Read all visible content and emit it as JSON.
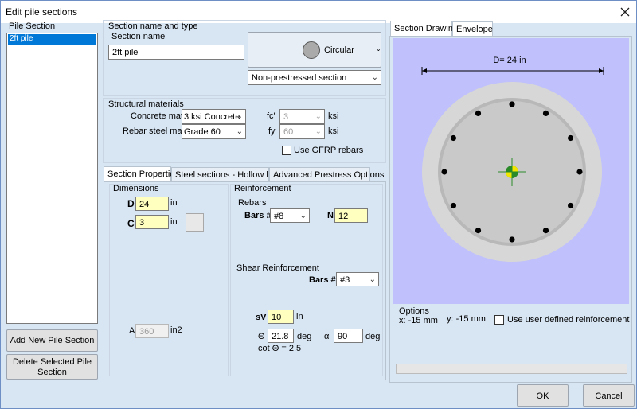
{
  "window": {
    "title": "Edit pile sections"
  },
  "pile_section_list": {
    "header": "Pile Section",
    "items": [
      "2ft pile"
    ],
    "selected_index": 0
  },
  "section_name_type": {
    "group_label": "Section name and type",
    "name_label": "Section name",
    "name_value": "2ft pile",
    "shape_button_label": "Circular",
    "prestress_select": "Non-prestressed section"
  },
  "materials": {
    "group_label": "Structural materials",
    "concrete_label": "Concrete mat.",
    "concrete_value": "3 ksi Concrete",
    "rebar_label": "Rebar steel mat.",
    "rebar_value": "Grade 60",
    "fc_label": "fc'",
    "fc_value": "3",
    "fc_unit": "ksi",
    "fy_label": "fy",
    "fy_value": "60",
    "fy_unit": "ksi",
    "gfrp_label": "Use GFRP rebars",
    "gfrp_checked": false
  },
  "tabs": {
    "items": [
      "Section Properties",
      "Steel sections - Hollow bars",
      "Advanced Prestress Options"
    ],
    "active_index": 0
  },
  "dimensions": {
    "group_label": "Dimensions",
    "d_label": "D",
    "d_value": "24",
    "d_unit": "in",
    "c_label": "C",
    "c_value": "3",
    "c_unit": "in",
    "a_label": "A",
    "a_value": "360",
    "a_unit": "in2"
  },
  "reinforcement": {
    "group_label": "Reinforcement",
    "rebars_label": "Rebars",
    "bars_label": "Bars #",
    "bars_value": "#8",
    "n_label": "N",
    "n_value": "12",
    "shear_label": "Shear Reinforcement",
    "shear_bars_label": "Bars #",
    "shear_bars_value": "#3",
    "sv_label": "sV",
    "sv_value": "10",
    "sv_unit": "in",
    "theta_label": "Θ",
    "theta_value": "21.8",
    "theta_unit": "deg",
    "alpha_label": "α",
    "alpha_value": "90",
    "alpha_unit": "deg",
    "cot_label": "cot Θ  = 2.5"
  },
  "buttons": {
    "add_pile": "Add New Pile Section",
    "delete_pile": "Delete Selected Pile Section",
    "ok": "OK",
    "cancel": "Cancel"
  },
  "drawing": {
    "tabs": [
      "Section Drawing",
      "Envelope"
    ],
    "active_index": 0,
    "dimension_label": "D= 24 in",
    "options_label": "Options",
    "x_coord": "x: -15 mm",
    "y_coord": "y: -15 mm",
    "user_reinf_label": "Use user defined reinforcement",
    "user_reinf_checked": false,
    "bar_count": 12,
    "colors": {
      "background": "#bfc0fc",
      "outer_circle": "#d7d7d7",
      "core_circle": "#b8b8b8",
      "inner_circle": "#c9c9c9",
      "rebar": "#000000",
      "centroid_green": "#2a8a2a",
      "centroid_yellow": "#f2e600"
    }
  },
  "icons": {
    "close": "close-icon",
    "shape_preview": "circle-shape-icon",
    "dropdown": "chevron-down-icon"
  }
}
